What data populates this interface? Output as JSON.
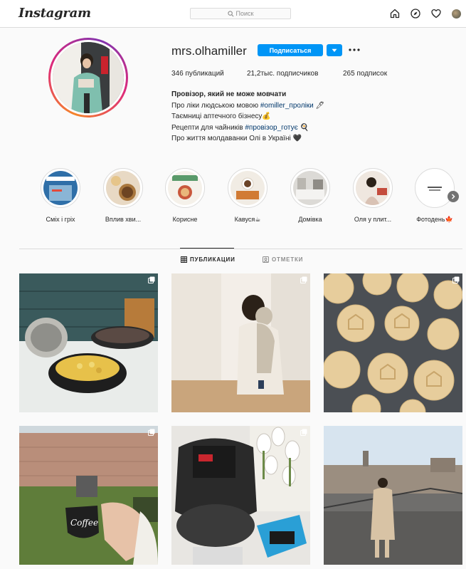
{
  "header": {
    "logo": "Instagram",
    "search_placeholder": "Поиск",
    "icons": [
      "home-icon",
      "explore-icon",
      "heart-icon",
      "profile-avatar"
    ]
  },
  "profile": {
    "username": "mrs.olhamiller",
    "follow_label": "Подписаться",
    "stats": {
      "posts": "346 публикаций",
      "followers": "21,2тыс. подписчиков",
      "following": "265 подписок"
    },
    "bio": {
      "name": "Провізор, який не може мовчати",
      "line1_text": "Про ліки людською мовою ",
      "line1_tag": "#omiller_проліки",
      "line1_emoji": " 🖊",
      "line2": "Таємниці аптечного бізнесу💰",
      "line3_text": "Рецепти для чайників ",
      "line3_tag": "#провізор_готує",
      "line3_emoji": " 🍳",
      "line4": "Про життя молдаванки Олі в Україні 🖤"
    }
  },
  "highlights": [
    {
      "label": "Сміх і гріх"
    },
    {
      "label": "Вплив хви..."
    },
    {
      "label": "Корисне"
    },
    {
      "label": "Кавуся☕"
    },
    {
      "label": "Домівка"
    },
    {
      "label": "Оля у плит..."
    },
    {
      "label": "Фотодень🍁"
    }
  ],
  "tabs": {
    "posts": "ПУБЛИКАЦИИ",
    "tagged": "ОТМЕТКИ"
  },
  "colors": {
    "accent": "#0095f6",
    "border": "#dbdbdb",
    "text": "#262626",
    "muted": "#8e8e8e"
  },
  "posts": [
    {
      "name": "post-kitchen-stove"
    },
    {
      "name": "post-mother-baby"
    },
    {
      "name": "post-cookies"
    },
    {
      "name": "post-coffee-garden"
    },
    {
      "name": "post-multicooker"
    },
    {
      "name": "post-rooftop"
    }
  ]
}
